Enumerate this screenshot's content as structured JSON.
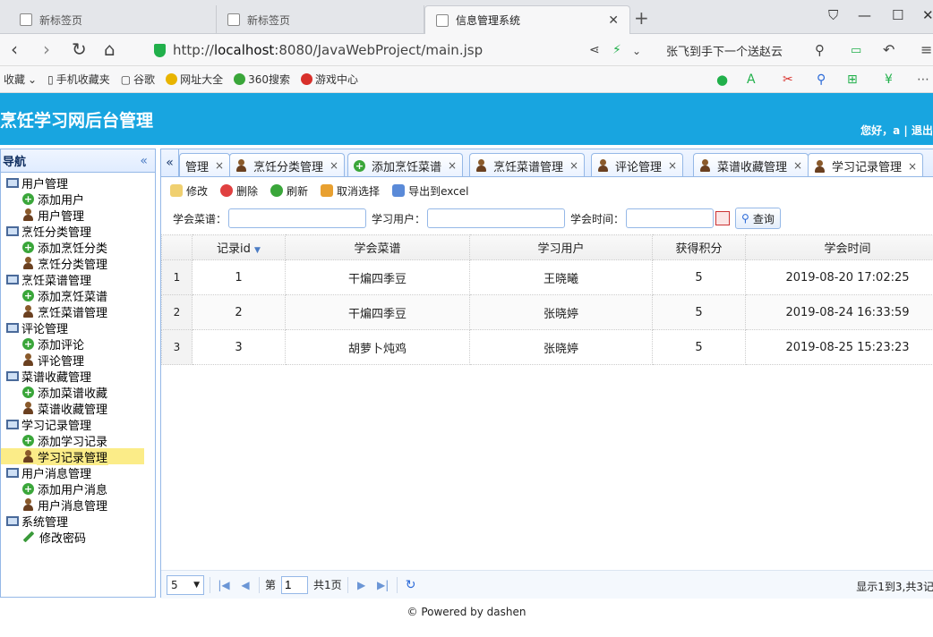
{
  "browser": {
    "tabs": [
      {
        "title": "新标签页"
      },
      {
        "title": "新标签页"
      },
      {
        "title": "信息管理系统"
      }
    ],
    "url_prefix": "http://",
    "url_host": "localhost",
    "url_rest": ":8080/JavaWebProject/main.jsp",
    "search_suggestion": "张飞到手下一个送赵云",
    "bookmarks": [
      "收藏",
      "手机收藏夹",
      "谷歌",
      "网址大全",
      "360搜索",
      "游戏中心"
    ],
    "icons": {
      "back": "back-arrow-icon",
      "forward": "forward-arrow-icon",
      "reload": "reload-icon",
      "home": "home-icon"
    }
  },
  "header": {
    "title": "烹饪学习网后台管理",
    "greeting": "您好，a",
    "separator": "|",
    "logout": "退出"
  },
  "nav": {
    "title": "导航",
    "groups": [
      {
        "label": "用户管理",
        "children": [
          {
            "label": "添加用户",
            "icon": "add"
          },
          {
            "label": "用户管理",
            "icon": "user"
          }
        ]
      },
      {
        "label": "烹饪分类管理",
        "children": [
          {
            "label": "添加烹饪分类",
            "icon": "add"
          },
          {
            "label": "烹饪分类管理",
            "icon": "user"
          }
        ]
      },
      {
        "label": "烹饪菜谱管理",
        "children": [
          {
            "label": "添加烹饪菜谱",
            "icon": "add"
          },
          {
            "label": "烹饪菜谱管理",
            "icon": "user"
          }
        ]
      },
      {
        "label": "评论管理",
        "children": [
          {
            "label": "添加评论",
            "icon": "add"
          },
          {
            "label": "评论管理",
            "icon": "user"
          }
        ]
      },
      {
        "label": "菜谱收藏管理",
        "children": [
          {
            "label": "添加菜谱收藏",
            "icon": "add"
          },
          {
            "label": "菜谱收藏管理",
            "icon": "user"
          }
        ]
      },
      {
        "label": "学习记录管理",
        "children": [
          {
            "label": "添加学习记录",
            "icon": "add"
          },
          {
            "label": "学习记录管理",
            "icon": "user",
            "selected": true
          }
        ]
      },
      {
        "label": "用户消息管理",
        "children": [
          {
            "label": "添加用户消息",
            "icon": "add"
          },
          {
            "label": "用户消息管理",
            "icon": "user"
          }
        ]
      },
      {
        "label": "系统管理",
        "children": [
          {
            "label": "修改密码",
            "icon": "pencil"
          }
        ]
      }
    ]
  },
  "page_tabs": [
    {
      "label": "管理",
      "icon": ""
    },
    {
      "label": "烹饪分类管理",
      "icon": "user"
    },
    {
      "label": "添加烹饪菜谱",
      "icon": "add"
    },
    {
      "label": "烹饪菜谱管理",
      "icon": "user"
    },
    {
      "label": "评论管理",
      "icon": "user"
    },
    {
      "label": "菜谱收藏管理",
      "icon": "user"
    },
    {
      "label": "学习记录管理",
      "icon": "user",
      "active": true
    }
  ],
  "toolbar": {
    "edit": "修改",
    "delete": "删除",
    "refresh": "刷新",
    "unselect": "取消选择",
    "export": "导出到excel"
  },
  "filters": {
    "recipe_label": "学会菜谱：",
    "recipe_value": "",
    "user_label": "学习用户：",
    "user_value": "",
    "time_label": "学会时间：",
    "time_value": "",
    "query": "查询"
  },
  "table": {
    "columns": [
      "记录id",
      "学会菜谱",
      "学习用户",
      "获得积分",
      "学会时间"
    ],
    "rows": [
      {
        "rownum": "1",
        "id": "1",
        "recipe": "干煸四季豆",
        "user": "王晓曦",
        "points": "5",
        "time": "2019-08-20 17:02:25"
      },
      {
        "rownum": "2",
        "id": "2",
        "recipe": "干煸四季豆",
        "user": "张晓婷",
        "points": "5",
        "time": "2019-08-24 16:33:59"
      },
      {
        "rownum": "3",
        "id": "3",
        "recipe": "胡萝卜炖鸡",
        "user": "张晓婷",
        "points": "5",
        "time": "2019-08-25 15:23:23"
      }
    ]
  },
  "pager": {
    "page_size": "5",
    "page_prefix": "第",
    "page_value": "1",
    "page_suffix": "共1页",
    "info": "显示1到3,共3记"
  },
  "footer": "© Powered by dashen",
  "colors": {
    "header_bg": "#18a5e0",
    "panel_border": "#95b8e7",
    "selected_bg": "#fbec88"
  }
}
